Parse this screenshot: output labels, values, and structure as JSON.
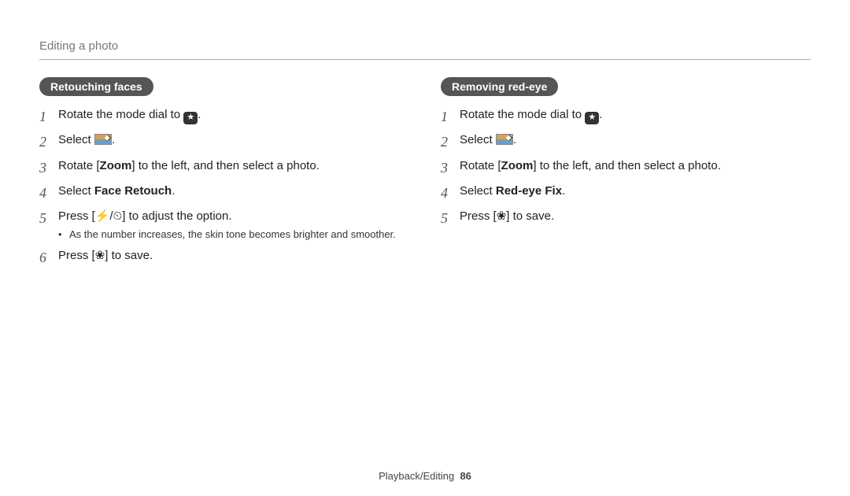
{
  "page_title": "Editing a photo",
  "footer": {
    "section": "Playback/Editing",
    "page": "86"
  },
  "icons": {
    "mode_star": "★",
    "flash": "⚡",
    "timer": "⏲",
    "flower": "❀"
  },
  "left": {
    "heading": "Retouching faces",
    "steps": [
      {
        "n": "1",
        "pre": "Rotate the mode dial to ",
        "icon": "mode_star",
        "post": "."
      },
      {
        "n": "2",
        "pre": "Select ",
        "icon": "edit",
        "post": "."
      },
      {
        "n": "3",
        "html": "Rotate [<b>Zoom</b>] to the left, and then select a photo."
      },
      {
        "n": "4",
        "html": "Select <b>Face Retouch</b>."
      },
      {
        "n": "5",
        "pre": "Press [",
        "icon": "flash_timer",
        "post": "] to adjust the option.",
        "sub": "As the number increases, the skin tone becomes brighter and smoother."
      },
      {
        "n": "6",
        "pre": "Press [",
        "icon": "flower",
        "post": "] to save."
      }
    ]
  },
  "right": {
    "heading": "Removing red-eye",
    "steps": [
      {
        "n": "1",
        "pre": "Rotate the mode dial to ",
        "icon": "mode_star",
        "post": "."
      },
      {
        "n": "2",
        "pre": "Select ",
        "icon": "edit",
        "post": "."
      },
      {
        "n": "3",
        "html": "Rotate [<b>Zoom</b>] to the left, and then select a photo."
      },
      {
        "n": "4",
        "html": "Select <b>Red-eye Fix</b>."
      },
      {
        "n": "5",
        "pre": "Press [",
        "icon": "flower",
        "post": "] to save."
      }
    ]
  }
}
